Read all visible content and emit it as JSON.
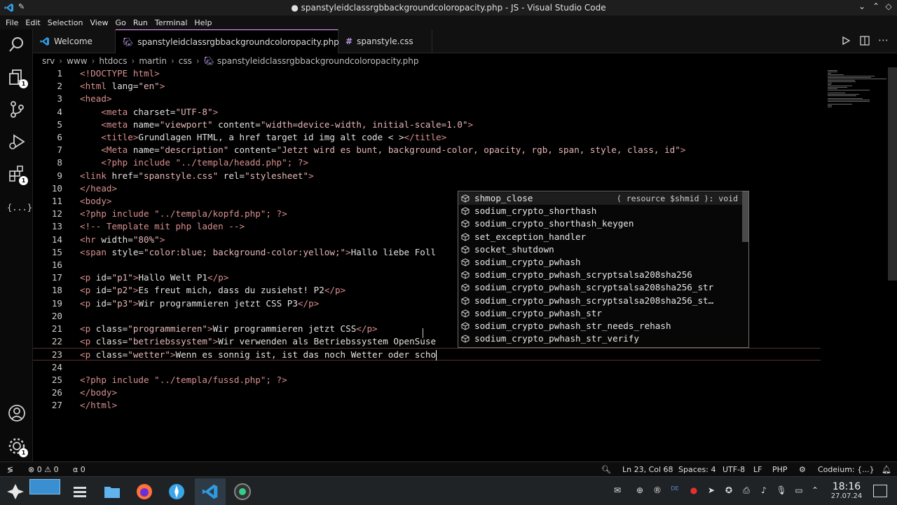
{
  "window": {
    "title": "● spanstyleidclassrgbbackgroundcoloropacity.php - JS - Visual Studio Code",
    "controls": [
      "⌄",
      "⌃",
      "◇",
      "✕"
    ]
  },
  "menu": [
    "File",
    "Edit",
    "Selection",
    "View",
    "Go",
    "Run",
    "Terminal",
    "Help"
  ],
  "activity": {
    "explorer_badge": "1",
    "extensions_badge": "1",
    "json_label": "{...}"
  },
  "tabs": [
    {
      "label": "Welcome"
    },
    {
      "label": "spanstyleidclassrgbbackgroundcoloropacity.php"
    },
    {
      "label": "spanstyle.css"
    }
  ],
  "breadcrumb": [
    "srv",
    "www",
    "htdocs",
    "martin",
    "css",
    "spanstyleidclassrgbbackgroundcoloropacity.php"
  ],
  "editor": {
    "line_numbers": [
      "1",
      "2",
      "3",
      "4",
      "5",
      "6",
      "7",
      "8",
      "9",
      "10",
      "11",
      "12",
      "13",
      "14",
      "15",
      "16",
      "17",
      "18",
      "19",
      "20",
      "21",
      "22",
      "23",
      "24",
      "25",
      "26",
      "27"
    ],
    "lines": [
      [
        [
          "tag",
          "<!DOCTYPE html>"
        ]
      ],
      [
        [
          "tag",
          "<html "
        ],
        [
          "attr",
          "lang="
        ],
        [
          "str",
          "\"en\""
        ],
        [
          "tag",
          ">"
        ]
      ],
      [
        [
          "tag",
          "<head>"
        ]
      ],
      [
        [
          "pad",
          "    "
        ],
        [
          "tag",
          "<meta "
        ],
        [
          "attr",
          "charset="
        ],
        [
          "str",
          "\"UTF-8\""
        ],
        [
          "tag",
          ">"
        ]
      ],
      [
        [
          "pad",
          "    "
        ],
        [
          "tag",
          "<meta "
        ],
        [
          "attr",
          "name="
        ],
        [
          "str",
          "\"viewport\" "
        ],
        [
          "attr",
          "content="
        ],
        [
          "str",
          "\"width=device-width, initial-scale=1.0\""
        ],
        [
          "tag",
          ">"
        ]
      ],
      [
        [
          "pad",
          "    "
        ],
        [
          "tag",
          "<title>"
        ],
        [
          "attr",
          "Grundlagen HTML, a href target id img alt code < >"
        ],
        [
          "tag",
          "</title>"
        ]
      ],
      [
        [
          "pad",
          "    "
        ],
        [
          "tag",
          "<Meta "
        ],
        [
          "attr",
          "name="
        ],
        [
          "str",
          "\"description\" "
        ],
        [
          "attr",
          "content="
        ],
        [
          "str",
          "\"Jetzt wird es bunt, background-color, opacity, rgb, span, style, class, id\""
        ],
        [
          "tag",
          ">"
        ]
      ],
      [
        [
          "pad",
          "    "
        ],
        [
          "php",
          "<?php include \"../templa/headd.php\"; ?>"
        ]
      ],
      [
        [
          "tag",
          "<link "
        ],
        [
          "attr",
          "href="
        ],
        [
          "str",
          "\"spanstyle.css\" "
        ],
        [
          "attr",
          "rel="
        ],
        [
          "str",
          "\"stylesheet\""
        ],
        [
          "tag",
          ">"
        ]
      ],
      [
        [
          "tag",
          "</head>"
        ]
      ],
      [
        [
          "tag",
          "<body>"
        ]
      ],
      [
        [
          "php",
          "<?php include \"../templa/kopfd.php\"; ?>"
        ]
      ],
      [
        [
          "comment",
          "<!-- Template mit php laden -->"
        ]
      ],
      [
        [
          "tag",
          "<hr "
        ],
        [
          "attr",
          "width="
        ],
        [
          "str",
          "\"80%\""
        ],
        [
          "tag",
          ">"
        ]
      ],
      [
        [
          "tag",
          "<span "
        ],
        [
          "attr",
          "style="
        ],
        [
          "str",
          "\"color:blue; background-color:yellow;\""
        ],
        [
          "tag",
          ">"
        ],
        [
          "attr",
          "Hallo liebe Foll"
        ]
      ],
      [],
      [
        [
          "tag",
          "<p "
        ],
        [
          "attr",
          "id="
        ],
        [
          "str",
          "\"p1\""
        ],
        [
          "tag",
          ">"
        ],
        [
          "attr",
          "Hallo Welt P1"
        ],
        [
          "tag",
          "</p>"
        ]
      ],
      [
        [
          "tag",
          "<p "
        ],
        [
          "attr",
          "id="
        ],
        [
          "str",
          "\"p2\""
        ],
        [
          "tag",
          ">"
        ],
        [
          "attr",
          "Es freut mich, dass du zusiehst! P2"
        ],
        [
          "tag",
          "</p>"
        ]
      ],
      [
        [
          "tag",
          "<p "
        ],
        [
          "attr",
          "id="
        ],
        [
          "str",
          "\"p3\""
        ],
        [
          "tag",
          ">"
        ],
        [
          "attr",
          "Wir programmieren jetzt CSS P3"
        ],
        [
          "tag",
          "</p>"
        ]
      ],
      [],
      [
        [
          "tag",
          "<p "
        ],
        [
          "attr",
          "class="
        ],
        [
          "str",
          "\"programmieren\""
        ],
        [
          "tag",
          ">"
        ],
        [
          "attr",
          "Wir programmieren jetzt CSS"
        ],
        [
          "tag",
          "</p>"
        ]
      ],
      [
        [
          "tag",
          "<p "
        ],
        [
          "attr",
          "class="
        ],
        [
          "str",
          "\"betriebssystem\""
        ],
        [
          "tag",
          ">"
        ],
        [
          "attr",
          "Wir verwenden als Betriebssystem OpenSuse"
        ]
      ],
      [
        [
          "tag",
          "<p "
        ],
        [
          "attr",
          "class="
        ],
        [
          "str",
          "\"wetter\""
        ],
        [
          "tag",
          ">"
        ],
        [
          "attr",
          "Wenn es sonnig ist, ist das noch Wetter oder scho"
        ]
      ],
      [],
      [
        [
          "php",
          "<?php include \"../templa/fussd.php\"; ?>"
        ]
      ],
      [
        [
          "tag",
          "</body>"
        ]
      ],
      [
        [
          "tag",
          "</html>"
        ]
      ]
    ]
  },
  "suggest": {
    "items": [
      {
        "label": "shmop_close",
        "detail": "( resource $shmid ): void"
      },
      {
        "label": "sodium_crypto_shorthash",
        "detail": ""
      },
      {
        "label": "sodium_crypto_shorthash_keygen",
        "detail": ""
      },
      {
        "label": "set_exception_handler",
        "detail": ""
      },
      {
        "label": "socket_shutdown",
        "detail": ""
      },
      {
        "label": "sodium_crypto_pwhash",
        "detail": ""
      },
      {
        "label": "sodium_crypto_pwhash_scryptsalsa208sha256",
        "detail": ""
      },
      {
        "label": "sodium_crypto_pwhash_scryptsalsa208sha256_str",
        "detail": ""
      },
      {
        "label": "sodium_crypto_pwhash_scryptsalsa208sha256_st…",
        "detail": ""
      },
      {
        "label": "sodium_crypto_pwhash_str",
        "detail": ""
      },
      {
        "label": "sodium_crypto_pwhash_str_needs_rehash",
        "detail": ""
      },
      {
        "label": "sodium_crypto_pwhash_str_verify",
        "detail": ""
      }
    ]
  },
  "status": {
    "errors": "0",
    "warnings": "0",
    "ports": "0",
    "position": "Ln 23, Col 68",
    "spaces": "Spaces: 4",
    "encoding": "UTF-8",
    "eol": "LF",
    "language": "PHP",
    "codeium": "Codeium: {...}"
  },
  "taskbar": {
    "time": "18:16",
    "date": "27.07.24",
    "tray_text": "DE"
  },
  "colors": {
    "accent_tab": "#e9a6ff",
    "tag": "#d98f8f",
    "string": "#e6b6b6",
    "cube_icon": "#b89be3"
  }
}
